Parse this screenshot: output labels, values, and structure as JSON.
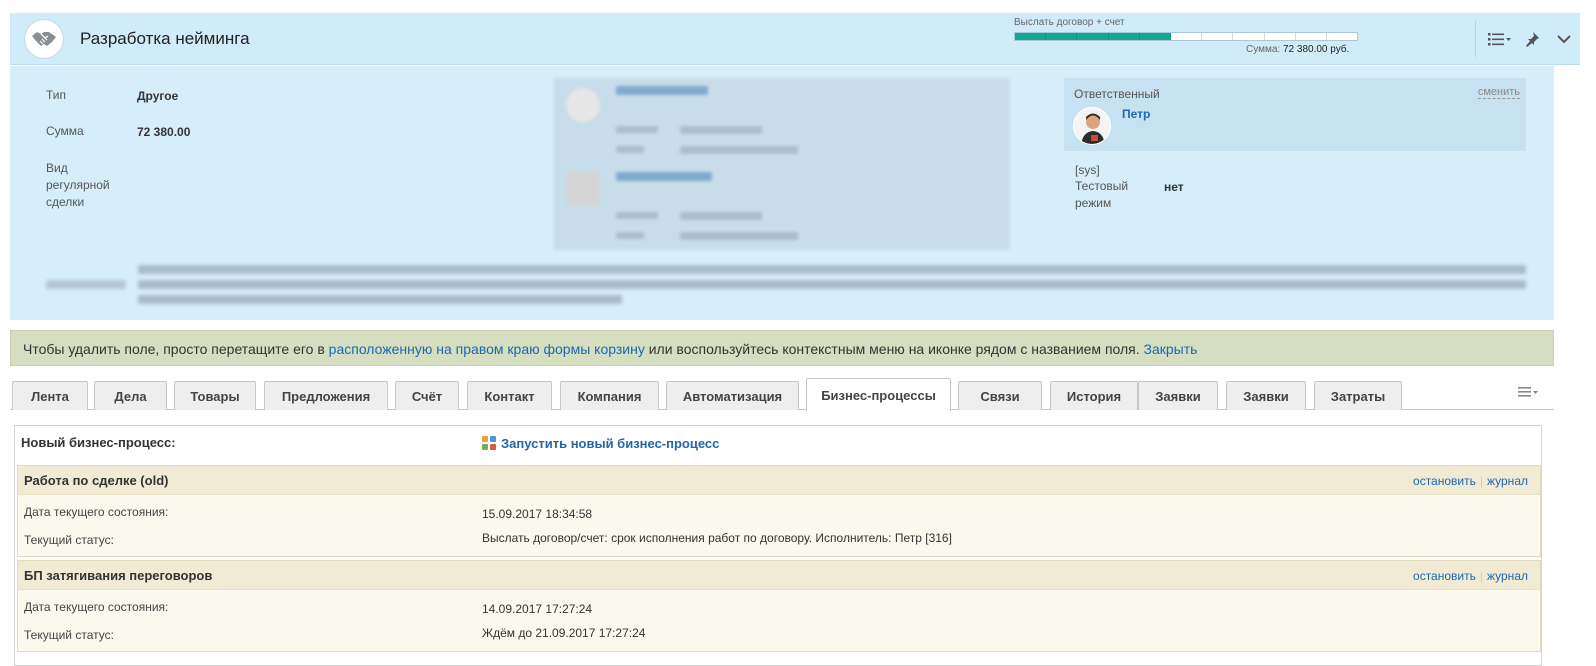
{
  "header": {
    "title": "Разработка нейминга",
    "stage_label": "Выслать договор + счет",
    "stage": {
      "completed": 5,
      "total": 11
    },
    "sum_label": "Сумма:",
    "sum_value": "72 380.00 руб.",
    "icons": [
      "handshake-icon",
      "list-settings-icon",
      "pin-icon",
      "chevron-down-icon"
    ]
  },
  "info": {
    "type_label": "Тип",
    "type_value": "Другое",
    "sum_label": "Сумма",
    "sum_value": "72 380.00",
    "recurring_label": "Вид регулярной сделки",
    "responsible_label": "Ответственный",
    "responsible_change": "сменить",
    "responsible_name": "Петр",
    "sys_label": "[sys]",
    "test_mode_label": "Тестовый режим",
    "test_mode_value": "нет"
  },
  "notice": {
    "text_before": "Чтобы удалить поле, просто перетащите его в ",
    "link_text": "расположенную на правом краю формы корзину",
    "text_after": " или воспользуйтесь контекстным меню на иконке рядом с названием поля. ",
    "close_text": "Закрыть"
  },
  "tabs": [
    {
      "label": "Лента"
    },
    {
      "label": "Дела"
    },
    {
      "label": "Товары"
    },
    {
      "label": "Предложения"
    },
    {
      "label": "Счёт"
    },
    {
      "label": "Контакт"
    },
    {
      "label": "Компания"
    },
    {
      "label": "Автоматизация"
    },
    {
      "label": "Бизнес-процессы"
    },
    {
      "label": "Связи"
    },
    {
      "label": "История"
    },
    {
      "label": "Заявки"
    },
    {
      "label": "Заявки"
    },
    {
      "label": "Затраты"
    }
  ],
  "active_tab": "Бизнес-процессы",
  "bp": {
    "new_label": "Новый бизнес-процесс:",
    "launch_label": "Запустить новый бизнес-процесс",
    "processes": [
      {
        "name": "Работа по сделке (old)",
        "stop": "остановить",
        "log": "журнал",
        "date_label": "Дата текущего состояния:",
        "date_value": "15.09.2017 18:34:58",
        "status_label": "Текущий статус:",
        "status_value": "Выслать договор/счет: срок исполнения работ по договору. Исполнитель: Петр [316]"
      },
      {
        "name": "БП затягивания переговоров",
        "stop": "остановить",
        "log": "журнал",
        "date_label": "Дата текущего состояния:",
        "date_value": "14.09.2017 17:27:24",
        "status_label": "Текущий статус:",
        "status_value": "Ждём до 21.09.2017 17:27:24"
      }
    ]
  }
}
